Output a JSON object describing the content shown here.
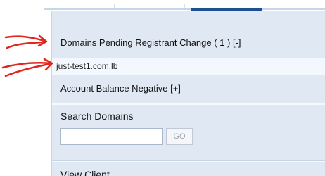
{
  "sidebar": {
    "pending_header": "Domains Pending Registrant Change ( 1 )  [-]",
    "pending_items": [
      "just-test1.com.lb"
    ],
    "balance_header": "Account Balance Negative  [+]",
    "search": {
      "title": "Search Domains",
      "input_value": "",
      "button_label": "GO"
    },
    "view_client": "View Client"
  },
  "annotations": {
    "arrow_color": "#e0261e",
    "icon": "red-arrow-icon"
  },
  "colors": {
    "panel_bg": "#e0e9f3",
    "item_bg": "#f2f8fd",
    "tab_accent": "#1f4f93"
  }
}
